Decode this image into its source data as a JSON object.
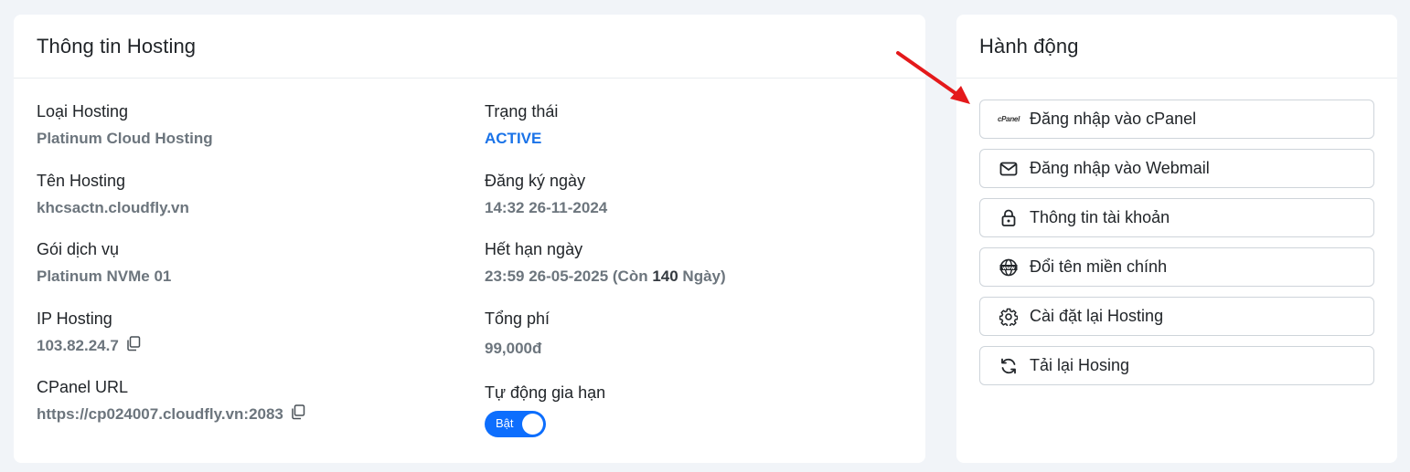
{
  "info_card": {
    "title": "Thông tin Hosting",
    "left": [
      {
        "label": "Loại Hosting",
        "value": "Platinum Cloud Hosting"
      },
      {
        "label": "Tên Hosting",
        "value": "khcsactn.cloudfly.vn"
      },
      {
        "label": "Gói dịch vụ",
        "value": "Platinum NVMe 01"
      },
      {
        "label": "IP Hosting",
        "value": "103.82.24.7"
      },
      {
        "label": "CPanel URL",
        "value": "https://cp024007.cloudfly.vn:2083"
      }
    ],
    "right": {
      "status_label": "Trạng thái",
      "status_value": "ACTIVE",
      "registered_label": "Đăng ký ngày",
      "registered_value": "14:32 26-11-2024",
      "expiry_label": "Hết hạn ngày",
      "expiry_prefix": "23:59 26-05-2025 (Còn ",
      "expiry_days": "140",
      "expiry_suffix": " Ngày)",
      "total_label": "Tổng phí",
      "total_value": "99,000đ",
      "auto_renew_label": "Tự động gia hạn",
      "auto_renew_toggle": "Bật",
      "auto_renew_on": true
    }
  },
  "actions_card": {
    "title": "Hành động",
    "buttons": [
      {
        "label": "Đăng nhập vào cPanel",
        "icon": "cpanel-logo-icon",
        "icon_text": "cPanel"
      },
      {
        "label": "Đăng nhập vào Webmail",
        "icon": "envelope-icon"
      },
      {
        "label": "Thông tin tài khoản",
        "icon": "lock-icon"
      },
      {
        "label": "Đổi tên miền chính",
        "icon": "www-globe-icon"
      },
      {
        "label": "Cài đặt lại Hosting",
        "icon": "gear-icon"
      },
      {
        "label": "Tải lại Hosing",
        "icon": "refresh-icon"
      }
    ]
  },
  "colors": {
    "accent": "#0d6efd",
    "status_active": "#1a73e8",
    "annotation_arrow": "#e4191b"
  }
}
